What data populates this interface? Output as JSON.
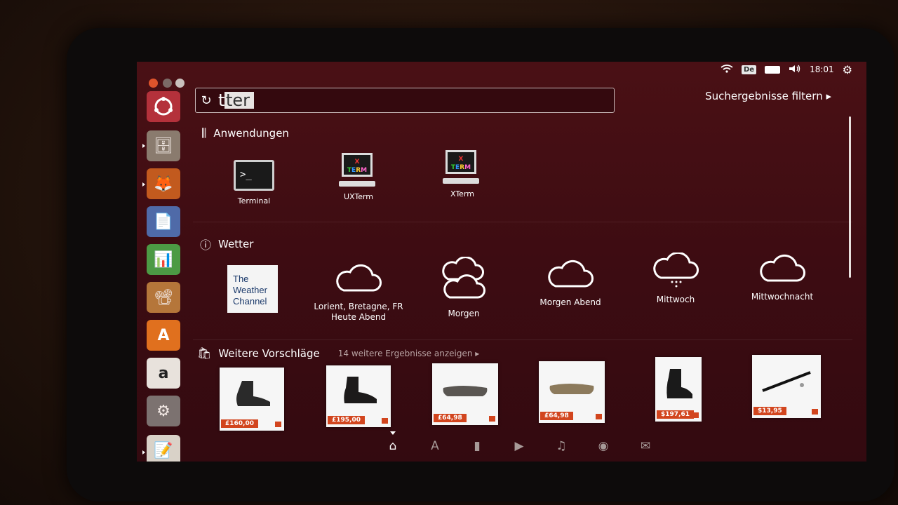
{
  "panel": {
    "keyboard_layout": "De",
    "clock": "18:01"
  },
  "search": {
    "query": "ter",
    "filter_label": "Suchergebnisse filtern ▸"
  },
  "sections": {
    "apps": {
      "title": "Anwendungen",
      "items": [
        {
          "label": "Terminal",
          "icon": "terminal-icon"
        },
        {
          "label": "UXTerm",
          "icon": "xterm-icon"
        },
        {
          "label": "XTerm",
          "icon": "xterm-icon"
        }
      ]
    },
    "weather": {
      "title": "Wetter",
      "provider_lines": [
        "The",
        "Weather",
        "Channel"
      ],
      "items": [
        {
          "label_line1": "Lorient, Bretagne, FR",
          "label_line2": "Heute Abend",
          "icon": "cloud-icon"
        },
        {
          "label_line1": "Morgen",
          "label_line2": "",
          "icon": "clouds-icon"
        },
        {
          "label_line1": "Morgen Abend",
          "label_line2": "",
          "icon": "cloud-icon"
        },
        {
          "label_line1": "Mittwoch",
          "label_line2": "",
          "icon": "snow-cloud-icon"
        },
        {
          "label_line1": "Mittwochnacht",
          "label_line2": "",
          "icon": "cloud-icon"
        }
      ]
    },
    "suggestions": {
      "title": "Weitere Vorschläge",
      "more_link": "14 weitere Ergebnisse anzeigen ▸",
      "items": [
        {
          "price": "£160,00"
        },
        {
          "price": "£195,00"
        },
        {
          "price": "£64,98"
        },
        {
          "price": "£64,98"
        },
        {
          "price": "$197,61"
        },
        {
          "price": "$13,95"
        }
      ]
    }
  },
  "lenses": [
    "home",
    "applications",
    "files",
    "video",
    "music",
    "photos",
    "social"
  ],
  "colors": {
    "accent": "#d2451e",
    "dash_bg": "#3d0c12"
  }
}
